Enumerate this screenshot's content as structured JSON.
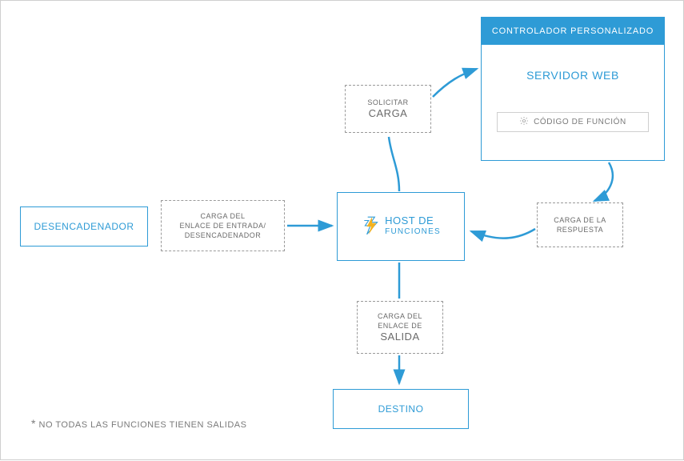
{
  "trigger": {
    "label": "DESENCADENADOR"
  },
  "input_payload": {
    "line1": "CARGA DEL",
    "line2": "ENLACE DE ENTRADA/",
    "line3": "DESENCADENADOR"
  },
  "functions_host": {
    "label_top": "HOST DE",
    "label_bottom": "FUNCIONES"
  },
  "request_payload": {
    "small": "SOLICITAR",
    "big": "CARGA"
  },
  "custom_controller": {
    "header": "CONTROLADOR  PERSONALIZADO",
    "server_label": "SERVIDOR WEB",
    "code_label": "CÓDIGO DE FUNCIÓN"
  },
  "response_payload": {
    "line1": "CARGA DE LA",
    "line2": "RESPUESTA"
  },
  "output_payload": {
    "line1": "CARGA DEL",
    "line2": "ENLACE DE",
    "big": "SALIDA"
  },
  "destination": {
    "label": "DESTINO"
  },
  "footnote": {
    "asterisk": "*",
    "text": "NO TODAS LAS FUNCIONES TIENEN SALIDAS"
  },
  "colors": {
    "accent": "#2e9bd6",
    "lightning_orange": "#f5b21f"
  }
}
